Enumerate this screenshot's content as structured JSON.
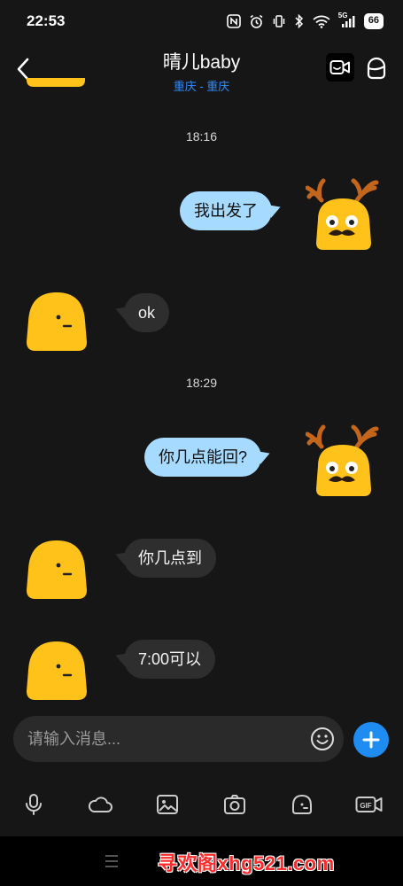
{
  "status_bar": {
    "time": "22:53",
    "signal_label": "5G",
    "battery": "66"
  },
  "header": {
    "title": "晴儿baby",
    "subtitle": "重庆 - 重庆",
    "subtitle_color": "#2f8bff"
  },
  "messages": [
    {
      "type": "timestamp",
      "text": "18:16"
    },
    {
      "type": "outgoing",
      "text": "我出发了"
    },
    {
      "type": "incoming",
      "text": "ok"
    },
    {
      "type": "timestamp",
      "text": "18:29"
    },
    {
      "type": "outgoing",
      "text": "你几点能回?"
    },
    {
      "type": "incoming",
      "text": "你几点到"
    },
    {
      "type": "incoming",
      "text": "7:00可以"
    }
  ],
  "input": {
    "placeholder": "请输入消息..."
  },
  "toolbar": {
    "items": [
      "microphone-icon",
      "cloud-icon",
      "image-icon",
      "camera-icon",
      "sticker-icon",
      "gif-icon"
    ],
    "gif_label": "GIF"
  },
  "watermark": "寻欢阁xhg521.com",
  "colors": {
    "accent": "#1e8cf0",
    "outgoing_bubble": "#a6dbff",
    "incoming_bubble": "#2e2e2e",
    "avatar_yellow": "#ffc21a"
  }
}
